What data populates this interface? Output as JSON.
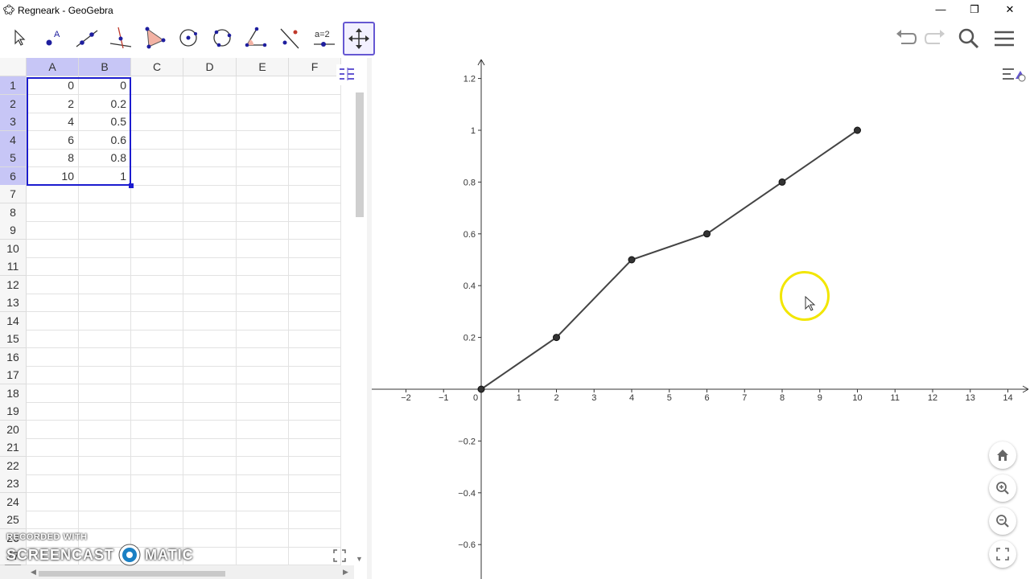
{
  "window": {
    "title": "Regneark - GeoGebra",
    "minimize": "—",
    "restore": "❐",
    "close": "✕"
  },
  "toolbar": {
    "tools": [
      "move-tool",
      "point-tool",
      "line-tool",
      "perpendicular-tool",
      "polygon-tool",
      "circle-center-tool",
      "circle-three-points-tool",
      "angle-tool",
      "reflect-tool",
      "slider-tool",
      "move-graphics-tool"
    ],
    "slider_label": "a=2"
  },
  "spreadsheet": {
    "columns": [
      "A",
      "B",
      "C",
      "D",
      "E",
      "F"
    ],
    "rows": [
      "1",
      "2",
      "3",
      "4",
      "5",
      "6",
      "7",
      "8",
      "9",
      "10",
      "11",
      "12",
      "13",
      "14",
      "15",
      "16",
      "17",
      "18",
      "19",
      "20",
      "21",
      "22",
      "23",
      "24",
      "25",
      "26",
      "27"
    ],
    "data": [
      {
        "A": "0",
        "B": "0"
      },
      {
        "A": "2",
        "B": "0.2"
      },
      {
        "A": "4",
        "B": "0.5"
      },
      {
        "A": "6",
        "B": "0.6"
      },
      {
        "A": "8",
        "B": "0.8"
      },
      {
        "A": "10",
        "B": "1"
      }
    ]
  },
  "watermark": {
    "line1": "RECORDED WITH",
    "line2a": "SCREENCAST",
    "line2b": "MATIC"
  },
  "chart_data": {
    "type": "line",
    "x": [
      0,
      2,
      4,
      6,
      8,
      10
    ],
    "y": [
      0,
      0.2,
      0.5,
      0.6,
      0.8,
      1
    ],
    "xlim": [
      -2.9,
      14.5
    ],
    "ylim": [
      -0.72,
      1.27
    ],
    "xticks": [
      "−2",
      "−1",
      "0",
      "1",
      "2",
      "3",
      "4",
      "5",
      "6",
      "7",
      "8",
      "9",
      "10",
      "11",
      "12",
      "13",
      "14"
    ],
    "yticks": [
      "−0.6",
      "−0.4",
      "−0.2",
      "0.2",
      "0.4",
      "0.6",
      "0.8",
      "1",
      "1.2"
    ],
    "grid": false,
    "line_color": "#444444",
    "point_color": "#333333"
  },
  "cursor_highlight_color": "#f2e600"
}
